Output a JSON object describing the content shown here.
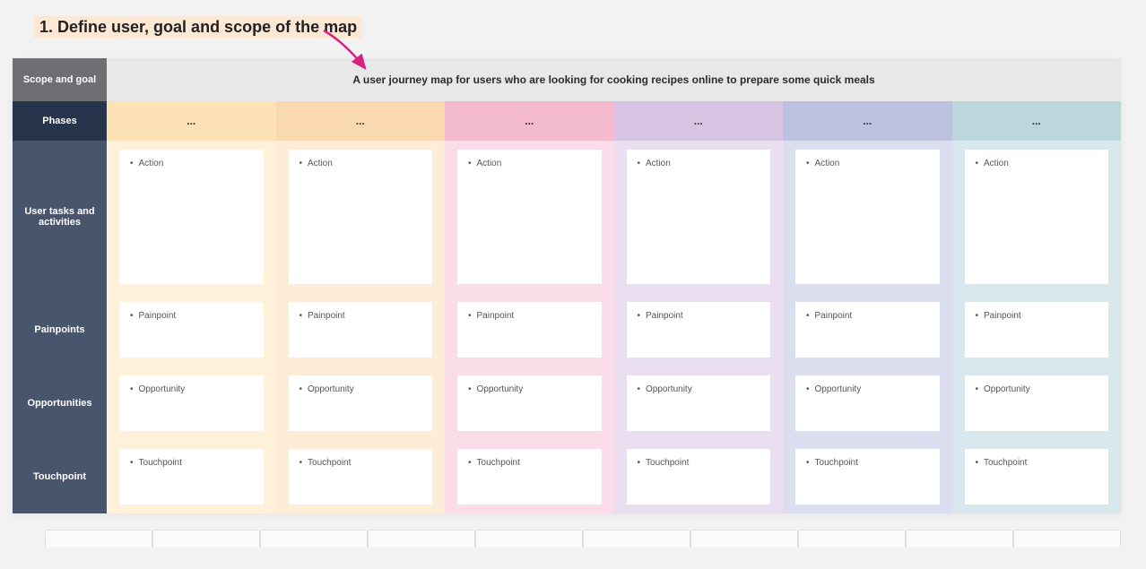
{
  "title": "1. Define user, goal and scope of the map",
  "scope": {
    "label": "Scope and goal",
    "description": "A user journey map for users who are looking for cooking recipes online to prepare some quick meals"
  },
  "phases_label": "Phases",
  "phases": [
    "...",
    "...",
    "...",
    "...",
    "...",
    "..."
  ],
  "rows": [
    {
      "label": "User tasks and activities",
      "item": "Action",
      "size": "tall"
    },
    {
      "label": "Painpoints",
      "item": "Painpoint",
      "size": "med"
    },
    {
      "label": "Opportunities",
      "item": "Opportunity",
      "size": "med"
    },
    {
      "label": "Touchpoint",
      "item": "Touchpoint",
      "size": "short"
    }
  ],
  "colors": {
    "phase_header": [
      "#fde2b5",
      "#fbd9b0",
      "#f4bacd",
      "#d7c3e2",
      "#bdc1e0",
      "#bcd6dd"
    ],
    "phase_body": [
      "#fff0d9",
      "#fcecd8",
      "#fadde9",
      "#e9dff0",
      "#dbdeee",
      "#d8e8ec"
    ]
  }
}
